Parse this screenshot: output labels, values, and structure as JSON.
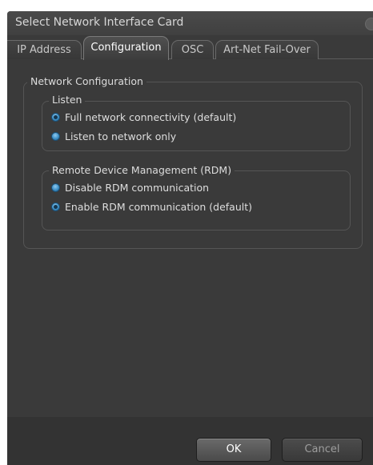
{
  "window": {
    "title": "Select Network Interface Card"
  },
  "tabs": [
    {
      "label": "IP Address",
      "active": false
    },
    {
      "label": "Configuration",
      "active": true
    },
    {
      "label": "OSC",
      "active": false
    },
    {
      "label": "Art-Net Fail-Over",
      "active": false
    }
  ],
  "network_config": {
    "title": "Network Configuration",
    "listen": {
      "title": "Listen",
      "options": [
        {
          "label": "Full network connectivity (default)",
          "checked": true
        },
        {
          "label": "Listen to network only",
          "checked": false
        }
      ]
    },
    "rdm": {
      "title": "Remote Device Management (RDM)",
      "options": [
        {
          "label": "Disable RDM communication",
          "checked": false
        },
        {
          "label": "Enable RDM communication (default)",
          "checked": true
        }
      ]
    }
  },
  "buttons": {
    "ok": "OK",
    "cancel": "Cancel"
  },
  "colors": {
    "window_bg": "#3a3a3a",
    "radio_accent": "#3d8fc6",
    "text": "#dedede"
  }
}
